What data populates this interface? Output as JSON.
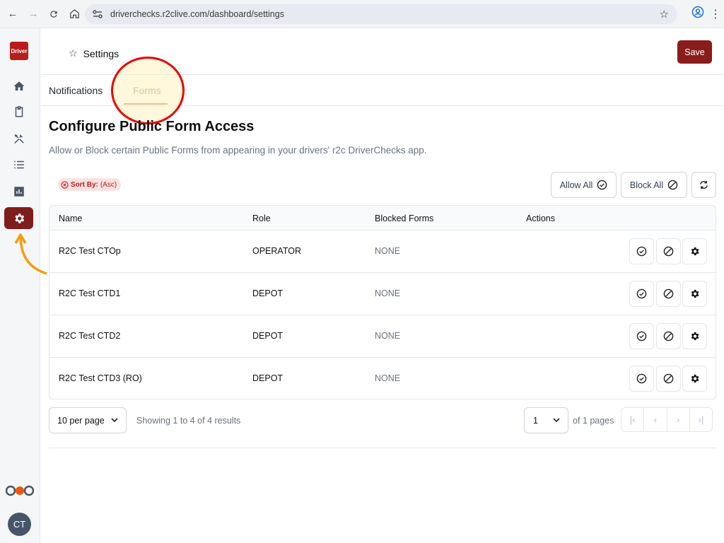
{
  "browser": {
    "url": "driverchecks.r2clive.com/dashboard/settings"
  },
  "sidebar": {
    "logo_text": "Driver",
    "brand_mark": "r2c",
    "avatar_initials": "CT",
    "items": [
      {
        "name": "home",
        "icon": "home-icon"
      },
      {
        "name": "checklist",
        "icon": "clipboard-icon"
      },
      {
        "name": "tools",
        "icon": "tools-icon"
      },
      {
        "name": "list",
        "icon": "list-icon"
      },
      {
        "name": "reports",
        "icon": "chart-icon"
      },
      {
        "name": "settings",
        "icon": "gear-icon",
        "active": true
      }
    ]
  },
  "header": {
    "title": "Settings",
    "save_label": "Save"
  },
  "tabs": [
    {
      "label": "Notifications",
      "active": false
    },
    {
      "label": "Forms",
      "active": true
    }
  ],
  "main": {
    "heading": "Configure Public Form Access",
    "description": "Allow or Block certain Public Forms from appearing in your drivers' r2c DriverChecks app.",
    "sort_badge": {
      "label": "Sort By:",
      "value": "(Asc)"
    },
    "allow_all_label": "Allow All",
    "block_all_label": "Block All"
  },
  "table": {
    "headers": [
      "Name",
      "Role",
      "Blocked Forms",
      "Actions"
    ],
    "rows": [
      {
        "name": "R2C Test CTOp",
        "role": "OPERATOR",
        "blocked": "NONE"
      },
      {
        "name": "R2C Test CTD1",
        "role": "DEPOT",
        "blocked": "NONE"
      },
      {
        "name": "R2C Test CTD2",
        "role": "DEPOT",
        "blocked": "NONE"
      },
      {
        "name": "R2C Test CTD3 (RO)",
        "role": "DEPOT",
        "blocked": "NONE"
      }
    ]
  },
  "pagination": {
    "per_page": "10 per page",
    "showing": "Showing 1 to 4 of 4 results",
    "current_page": "1",
    "of_pages": "of 1 pages"
  },
  "colors": {
    "brand": "#8b1c1c",
    "active_tab": "#c8a27a",
    "annotation": "#ee0000"
  }
}
